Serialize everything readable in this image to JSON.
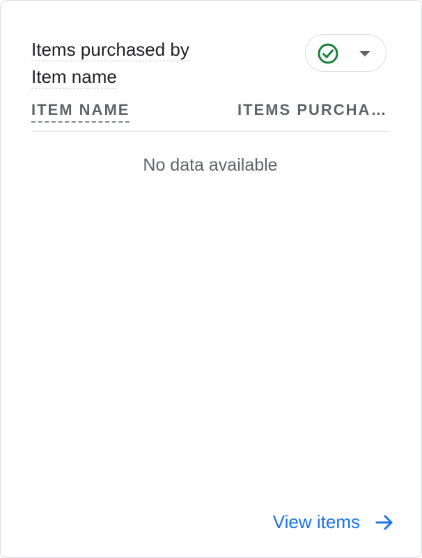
{
  "card": {
    "title": "Items purchased by Item name",
    "title_line1": "Items purchased by",
    "title_line2": "Item name",
    "status_icon": "check-circle-icon",
    "dropdown_icon": "caret-down-icon",
    "colors": {
      "accent": "#1a73e8",
      "success": "#188038",
      "text_primary": "#202124",
      "text_secondary": "#5f6368",
      "border": "#dadce0"
    }
  },
  "table": {
    "columns": [
      "ITEM NAME",
      "ITEMS PURCHASED"
    ],
    "columns_display": [
      "ITEM NAME",
      "ITEMS PURCHA…"
    ],
    "rows": [],
    "empty_message": "No data available"
  },
  "footer": {
    "link_label": "View items",
    "link_icon": "arrow-right-icon"
  }
}
